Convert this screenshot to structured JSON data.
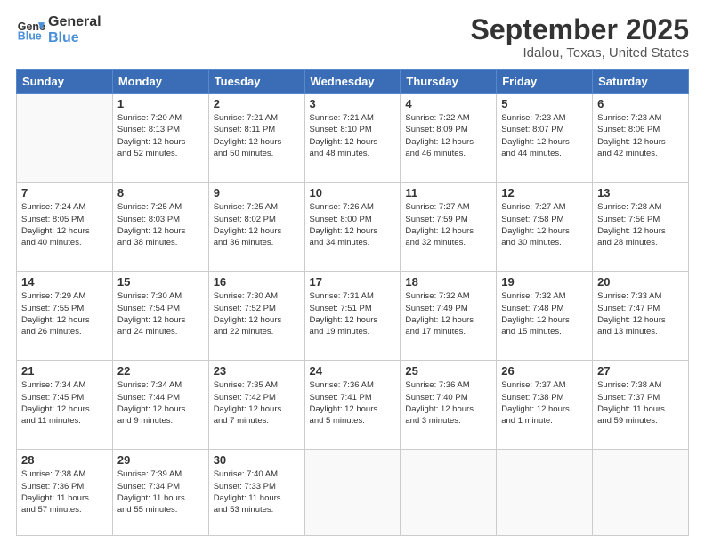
{
  "header": {
    "logo_line1": "General",
    "logo_line2": "Blue",
    "month": "September 2025",
    "location": "Idalou, Texas, United States"
  },
  "weekdays": [
    "Sunday",
    "Monday",
    "Tuesday",
    "Wednesday",
    "Thursday",
    "Friday",
    "Saturday"
  ],
  "weeks": [
    [
      {
        "day": "",
        "info": ""
      },
      {
        "day": "1",
        "info": "Sunrise: 7:20 AM\nSunset: 8:13 PM\nDaylight: 12 hours\nand 52 minutes."
      },
      {
        "day": "2",
        "info": "Sunrise: 7:21 AM\nSunset: 8:11 PM\nDaylight: 12 hours\nand 50 minutes."
      },
      {
        "day": "3",
        "info": "Sunrise: 7:21 AM\nSunset: 8:10 PM\nDaylight: 12 hours\nand 48 minutes."
      },
      {
        "day": "4",
        "info": "Sunrise: 7:22 AM\nSunset: 8:09 PM\nDaylight: 12 hours\nand 46 minutes."
      },
      {
        "day": "5",
        "info": "Sunrise: 7:23 AM\nSunset: 8:07 PM\nDaylight: 12 hours\nand 44 minutes."
      },
      {
        "day": "6",
        "info": "Sunrise: 7:23 AM\nSunset: 8:06 PM\nDaylight: 12 hours\nand 42 minutes."
      }
    ],
    [
      {
        "day": "7",
        "info": "Sunrise: 7:24 AM\nSunset: 8:05 PM\nDaylight: 12 hours\nand 40 minutes."
      },
      {
        "day": "8",
        "info": "Sunrise: 7:25 AM\nSunset: 8:03 PM\nDaylight: 12 hours\nand 38 minutes."
      },
      {
        "day": "9",
        "info": "Sunrise: 7:25 AM\nSunset: 8:02 PM\nDaylight: 12 hours\nand 36 minutes."
      },
      {
        "day": "10",
        "info": "Sunrise: 7:26 AM\nSunset: 8:00 PM\nDaylight: 12 hours\nand 34 minutes."
      },
      {
        "day": "11",
        "info": "Sunrise: 7:27 AM\nSunset: 7:59 PM\nDaylight: 12 hours\nand 32 minutes."
      },
      {
        "day": "12",
        "info": "Sunrise: 7:27 AM\nSunset: 7:58 PM\nDaylight: 12 hours\nand 30 minutes."
      },
      {
        "day": "13",
        "info": "Sunrise: 7:28 AM\nSunset: 7:56 PM\nDaylight: 12 hours\nand 28 minutes."
      }
    ],
    [
      {
        "day": "14",
        "info": "Sunrise: 7:29 AM\nSunset: 7:55 PM\nDaylight: 12 hours\nand 26 minutes."
      },
      {
        "day": "15",
        "info": "Sunrise: 7:30 AM\nSunset: 7:54 PM\nDaylight: 12 hours\nand 24 minutes."
      },
      {
        "day": "16",
        "info": "Sunrise: 7:30 AM\nSunset: 7:52 PM\nDaylight: 12 hours\nand 22 minutes."
      },
      {
        "day": "17",
        "info": "Sunrise: 7:31 AM\nSunset: 7:51 PM\nDaylight: 12 hours\nand 19 minutes."
      },
      {
        "day": "18",
        "info": "Sunrise: 7:32 AM\nSunset: 7:49 PM\nDaylight: 12 hours\nand 17 minutes."
      },
      {
        "day": "19",
        "info": "Sunrise: 7:32 AM\nSunset: 7:48 PM\nDaylight: 12 hours\nand 15 minutes."
      },
      {
        "day": "20",
        "info": "Sunrise: 7:33 AM\nSunset: 7:47 PM\nDaylight: 12 hours\nand 13 minutes."
      }
    ],
    [
      {
        "day": "21",
        "info": "Sunrise: 7:34 AM\nSunset: 7:45 PM\nDaylight: 12 hours\nand 11 minutes."
      },
      {
        "day": "22",
        "info": "Sunrise: 7:34 AM\nSunset: 7:44 PM\nDaylight: 12 hours\nand 9 minutes."
      },
      {
        "day": "23",
        "info": "Sunrise: 7:35 AM\nSunset: 7:42 PM\nDaylight: 12 hours\nand 7 minutes."
      },
      {
        "day": "24",
        "info": "Sunrise: 7:36 AM\nSunset: 7:41 PM\nDaylight: 12 hours\nand 5 minutes."
      },
      {
        "day": "25",
        "info": "Sunrise: 7:36 AM\nSunset: 7:40 PM\nDaylight: 12 hours\nand 3 minutes."
      },
      {
        "day": "26",
        "info": "Sunrise: 7:37 AM\nSunset: 7:38 PM\nDaylight: 12 hours\nand 1 minute."
      },
      {
        "day": "27",
        "info": "Sunrise: 7:38 AM\nSunset: 7:37 PM\nDaylight: 11 hours\nand 59 minutes."
      }
    ],
    [
      {
        "day": "28",
        "info": "Sunrise: 7:38 AM\nSunset: 7:36 PM\nDaylight: 11 hours\nand 57 minutes."
      },
      {
        "day": "29",
        "info": "Sunrise: 7:39 AM\nSunset: 7:34 PM\nDaylight: 11 hours\nand 55 minutes."
      },
      {
        "day": "30",
        "info": "Sunrise: 7:40 AM\nSunset: 7:33 PM\nDaylight: 11 hours\nand 53 minutes."
      },
      {
        "day": "",
        "info": ""
      },
      {
        "day": "",
        "info": ""
      },
      {
        "day": "",
        "info": ""
      },
      {
        "day": "",
        "info": ""
      }
    ]
  ]
}
